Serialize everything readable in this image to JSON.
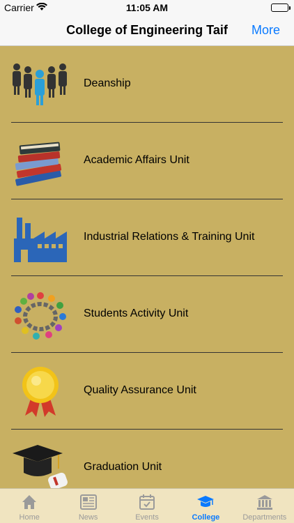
{
  "status": {
    "carrier": "Carrier",
    "time": "11:05 AM"
  },
  "nav": {
    "title": "College of Engineering Taif",
    "more_label": "More"
  },
  "list": [
    {
      "label": "Deanship",
      "icon": "people-group-icon"
    },
    {
      "label": "Academic Affairs Unit",
      "icon": "books-stack-icon"
    },
    {
      "label": "Industrial Relations & Training Unit",
      "icon": "factory-icon"
    },
    {
      "label": "Students Activity Unit",
      "icon": "people-circle-icon"
    },
    {
      "label": "Quality Assurance Unit",
      "icon": "award-medal-icon"
    },
    {
      "label": "Graduation Unit",
      "icon": "graduation-cap-icon"
    }
  ],
  "tabs": [
    {
      "label": "Home",
      "icon": "home-icon",
      "active": false
    },
    {
      "label": "News",
      "icon": "newspaper-icon",
      "active": false
    },
    {
      "label": "Events",
      "icon": "calendar-icon",
      "active": false
    },
    {
      "label": "College",
      "icon": "graduation-cap-icon",
      "active": true
    },
    {
      "label": "Departments",
      "icon": "building-icon",
      "active": false
    }
  ],
  "colors": {
    "background": "#c8b062",
    "accent": "#0a7aff",
    "tab_bar": "#f0e4c0"
  }
}
